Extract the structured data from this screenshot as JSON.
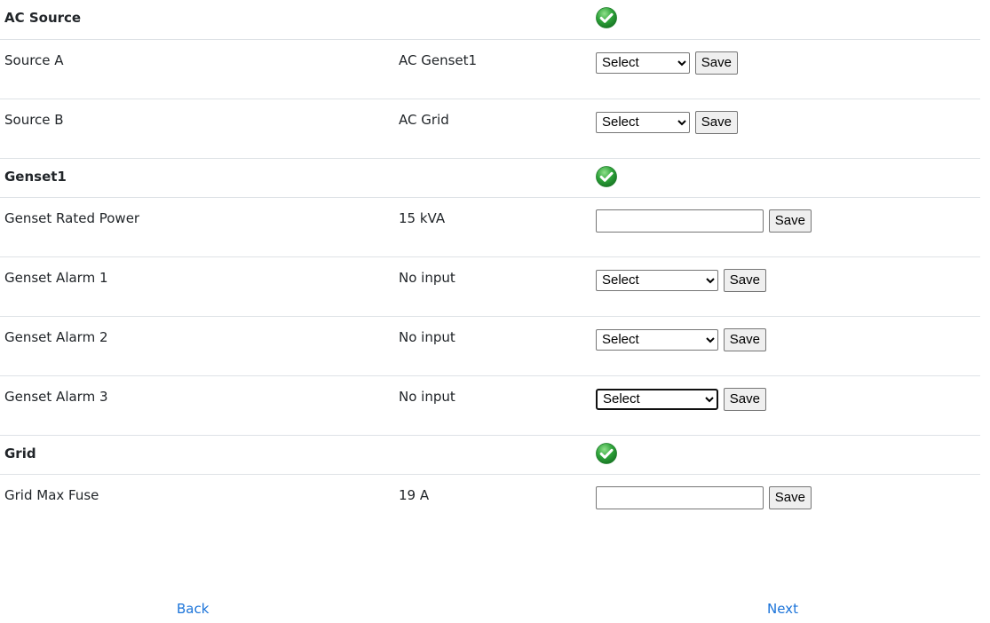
{
  "sections": [
    {
      "title": "AC Source",
      "status_icon": "check-circle-icon",
      "rows": [
        {
          "label": "Source A",
          "value": "AC Genset1",
          "control": "select",
          "select_value": "Select",
          "save_label": "Save"
        },
        {
          "label": "Source B",
          "value": "AC Grid",
          "control": "select",
          "select_value": "Select",
          "save_label": "Save"
        }
      ]
    },
    {
      "title": "Genset1",
      "status_icon": "check-circle-icon",
      "rows": [
        {
          "label": "Genset Rated Power",
          "value": "15 kVA",
          "control": "text",
          "input_value": "",
          "save_label": "Save"
        },
        {
          "label": "Genset Alarm 1",
          "value": "No input",
          "control": "select",
          "select_value": "Select",
          "save_label": "Save"
        },
        {
          "label": "Genset Alarm 2",
          "value": "No input",
          "control": "select",
          "select_value": "Select",
          "save_label": "Save"
        },
        {
          "label": "Genset Alarm 3",
          "value": "No input",
          "control": "select",
          "select_value": "Select",
          "save_label": "Save"
        }
      ]
    },
    {
      "title": "Grid",
      "status_icon": "check-circle-icon",
      "rows": [
        {
          "label": "Grid Max Fuse",
          "value": "19 A",
          "control": "text",
          "input_value": "",
          "save_label": "Save"
        }
      ]
    }
  ],
  "nav": {
    "back_label": "Back",
    "next_label": "Next"
  },
  "colors": {
    "link": "#1a73d9",
    "check_green": "#2ea33a",
    "divider": "#dee2e6"
  }
}
